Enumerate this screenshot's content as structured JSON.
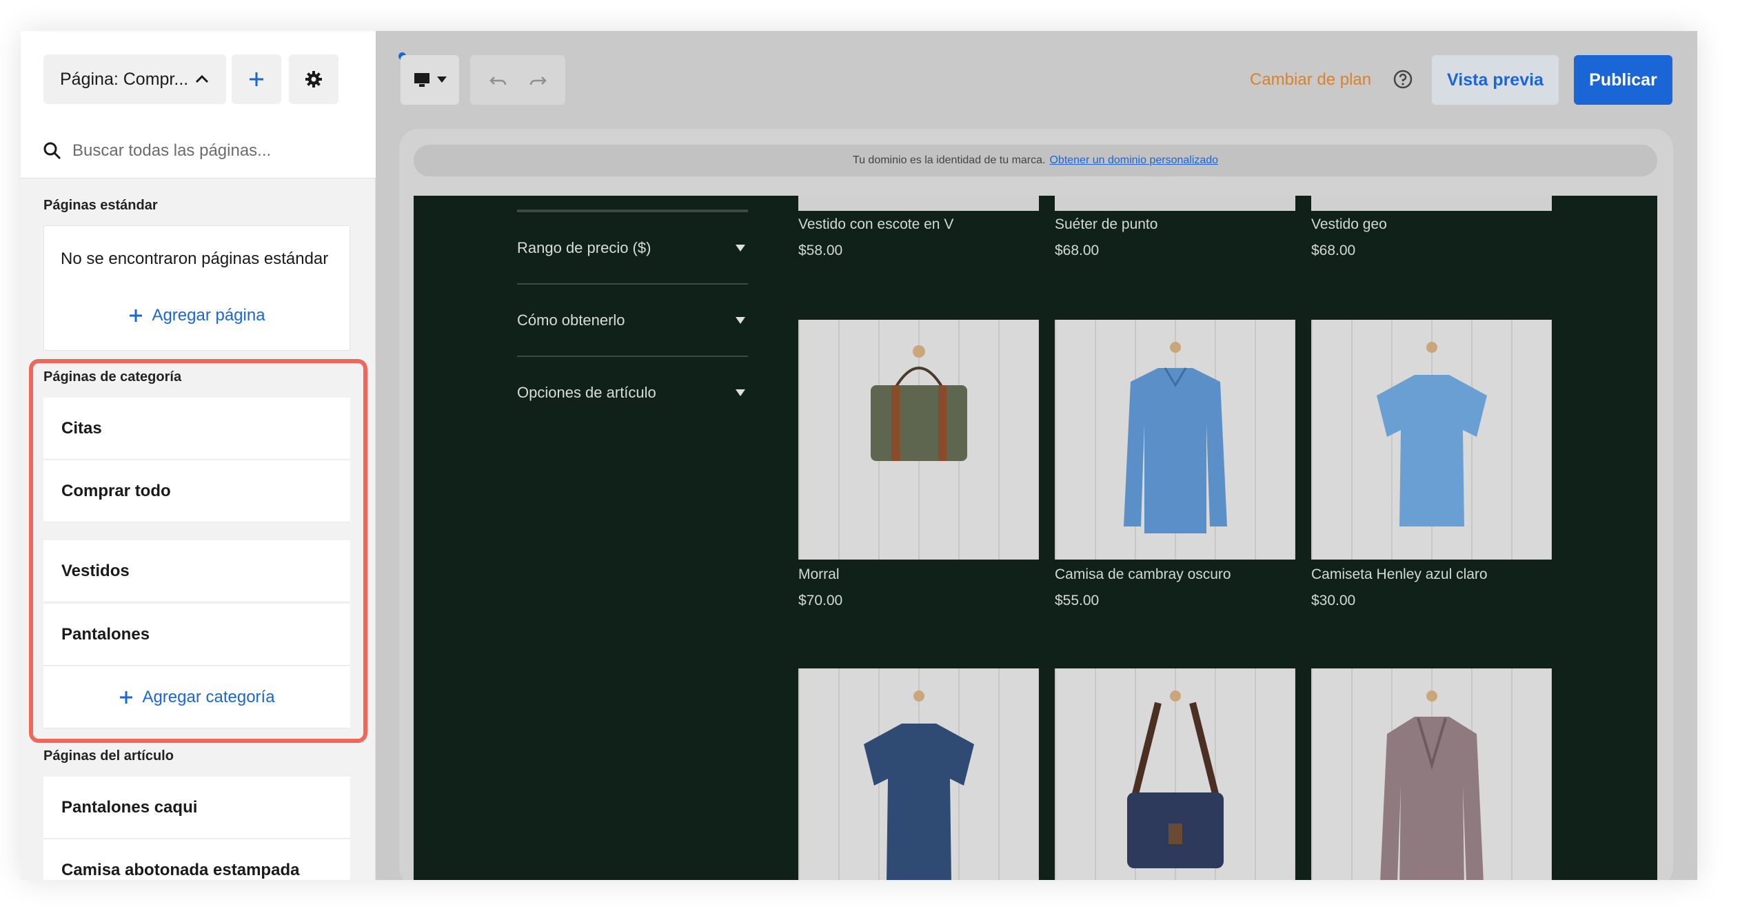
{
  "sidebar": {
    "page_select_label": "Página: Compr...",
    "search_placeholder": "Buscar todas las páginas...",
    "standard": {
      "title": "Páginas estándar",
      "empty_text": "No se encontraron páginas estándar",
      "add_label": "Agregar página"
    },
    "category": {
      "title": "Páginas de categoría",
      "items": [
        {
          "label": "Citas"
        },
        {
          "label": "Comprar todo"
        },
        {
          "label": "Vestidos"
        },
        {
          "label": "Pantalones"
        }
      ],
      "add_label": "Agregar categoría"
    },
    "item_pages": {
      "title": "Páginas del artículo",
      "items": [
        {
          "label": "Pantalones caqui"
        },
        {
          "label": "Camisa abotonada estampada"
        }
      ]
    }
  },
  "toolbar": {
    "change_plan": "Cambiar de plan",
    "preview": "Vista previa",
    "publish": "Publicar"
  },
  "banner": {
    "text": "Tu dominio es la identidad de tu marca.",
    "link": "Obtener un dominio personalizado"
  },
  "store": {
    "filters": [
      {
        "label": "Rango de precio ($)"
      },
      {
        "label": "Cómo obtenerlo"
      },
      {
        "label": "Opciones de artículo"
      }
    ],
    "top_products": [
      {
        "name": "Vestido con escote en V",
        "price": "$58.00"
      },
      {
        "name": "Suéter de punto",
        "price": "$68.00"
      },
      {
        "name": "Vestido geo",
        "price": "$68.00"
      }
    ],
    "products": [
      {
        "name": "Morral",
        "price": "$70.00",
        "icon": "bag-image"
      },
      {
        "name": "Camisa de cambray oscuro",
        "price": "$55.00",
        "icon": "shirt-image"
      },
      {
        "name": "Camiseta Henley azul claro",
        "price": "$30.00",
        "icon": "tshirt-image"
      }
    ],
    "bottom_products": [
      {
        "icon": "tshirt-image"
      },
      {
        "icon": "bag-image"
      },
      {
        "icon": "jacket-image"
      }
    ]
  },
  "colors": {
    "accent": "#1a66d6",
    "plan_link": "#d9822b",
    "highlight": "#f0675a",
    "store_bg": "#10211a"
  }
}
